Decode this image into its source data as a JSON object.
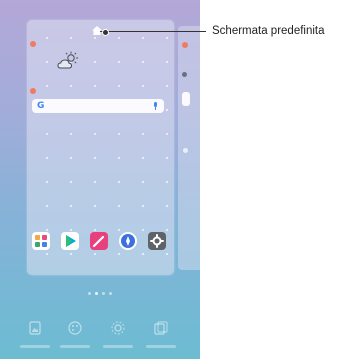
{
  "callout": {
    "label": "Schermata predefinita"
  },
  "home_screen": {
    "widgets": {
      "weather_icon": "cloud-sun-icon",
      "search_bar": {
        "logo": "G",
        "mic_icon": "mic-icon"
      }
    },
    "dock_apps": [
      {
        "name": "folder-icon",
        "color": "#ffffff"
      },
      {
        "name": "play-store-icon",
        "color": "#ffffff"
      },
      {
        "name": "pen-app-icon",
        "color": "#e8407c"
      },
      {
        "name": "compass-app-icon",
        "color": "#3d6fe0"
      },
      {
        "name": "settings-app-icon",
        "color": "#5f6368"
      }
    ],
    "bottom_toolbar": [
      {
        "name": "wallpaper-icon"
      },
      {
        "name": "themes-icon"
      },
      {
        "name": "settings-icon"
      },
      {
        "name": "widgets-icon"
      }
    ]
  },
  "colors": {
    "notification_dot": "#f17a62",
    "callout_line": "#333333"
  }
}
